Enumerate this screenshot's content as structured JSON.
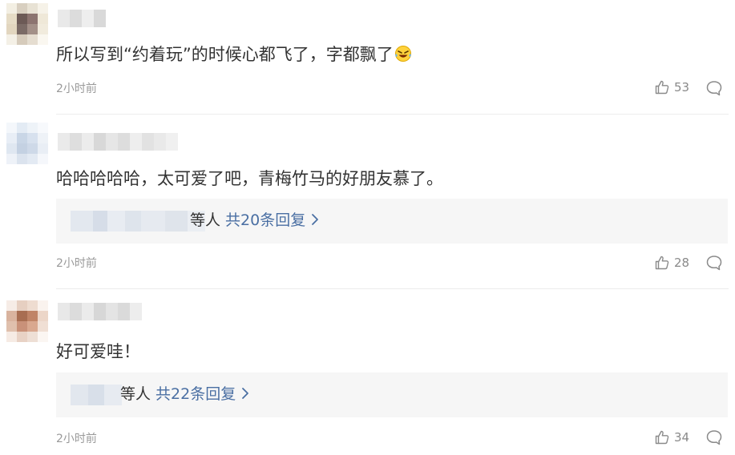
{
  "comments": [
    {
      "text": "所以写到“约着玩”的时候心都飞了，字都飘了",
      "emoji_icon": "laughing-tears-emoji",
      "time": "2小时前",
      "likes": "53"
    },
    {
      "text": "哈哈哈哈哈，太可爱了吧，青梅竹马的好朋友慕了。",
      "replies": {
        "suffix": "等人",
        "total": "共20条回复"
      },
      "time": "2小时前",
      "likes": "28"
    },
    {
      "text": "好可爱哇！",
      "replies": {
        "suffix": "等人",
        "total": "共22条回复"
      },
      "time": "2小时前",
      "likes": "34"
    }
  ],
  "icons": {
    "like": "thumbs-up-icon",
    "reply": "comment-bubble-icon",
    "expand": "chevron-right-icon"
  },
  "colors": {
    "text": "#333333",
    "meta": "#9a9a9a",
    "link": "#4a6fa3",
    "reply_bg": "#f6f6f6"
  }
}
